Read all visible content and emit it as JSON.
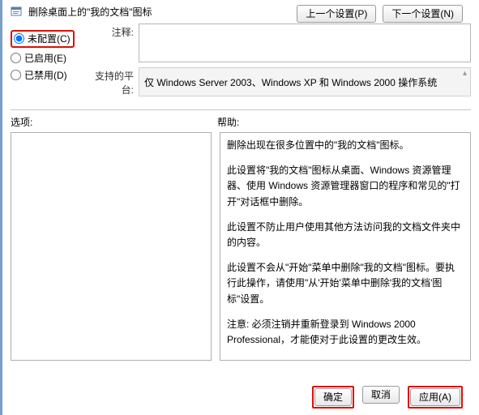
{
  "title": "删除桌面上的\"我的文档\"图标",
  "nav": {
    "prev": "上一个设置(P)",
    "next": "下一个设置(N)"
  },
  "radios": {
    "not_configured": "未配置(C)",
    "enabled": "已启用(E)",
    "disabled": "已禁用(D)",
    "selected": "not_configured"
  },
  "labels": {
    "comment": "注释:",
    "platform": "支持的平台:",
    "options": "选项:",
    "help": "帮助:"
  },
  "comment_value": "",
  "platform_text": "仅 Windows Server 2003、Windows XP 和 Windows 2000 操作系统",
  "help_paragraphs": [
    "删除出现在很多位置中的\"我的文档\"图标。",
    "此设置将\"我的文档\"图标从桌面、Windows 资源管理器、使用 Windows 资源管理器窗口的程序和常见的\"打开\"对话框中删除。",
    "此设置不防止用户使用其他方法访问我的文档文件夹中的内容。",
    "此设置不会从\"开始\"菜单中删除\"我的文档\"图标。要执行此操作，请使用\"从'开始'菜单中删除'我的文档'图标\"设置。",
    "注意: 必须注销并重新登录到 Windows 2000 Professional，才能使对于此设置的更改生效。"
  ],
  "buttons": {
    "ok": "确定",
    "cancel": "取消",
    "apply": "应用(A)"
  }
}
